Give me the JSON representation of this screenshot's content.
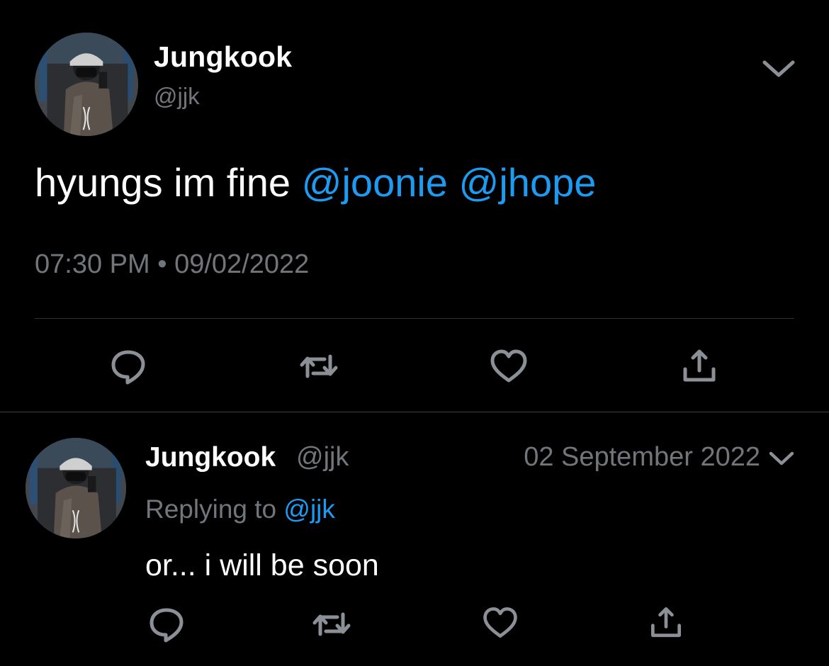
{
  "main_tweet": {
    "author_name": "Jungkook",
    "author_handle": "@jjk",
    "text_plain": "hyungs im fine ",
    "mention_1": "@joonie",
    "mention_2": "@jhope",
    "time": "07:30 PM",
    "separator": "•",
    "date": "09/02/2022"
  },
  "reply_tweet": {
    "author_name": "Jungkook",
    "author_handle": "@jjk",
    "date": "02 September 2022",
    "replying_to_label": "Replying to",
    "replying_to_handle": "@jjk",
    "text": "or... i will be soon"
  },
  "icons": {
    "reply": "reply-icon",
    "retweet": "retweet-icon",
    "like": "heart-icon",
    "share": "share-icon",
    "more": "chevron-down-icon"
  },
  "colors": {
    "background": "#000000",
    "text": "#ffffff",
    "secondary": "#71767b",
    "accent": "#1d9bf0",
    "divider": "#2f3336"
  }
}
